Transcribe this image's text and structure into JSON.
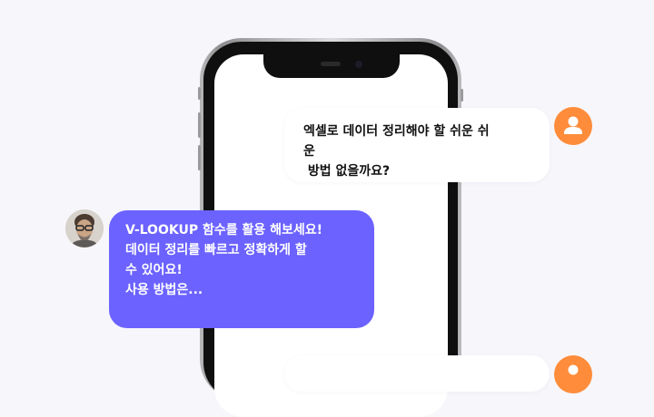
{
  "messages": [
    {
      "role": "user",
      "text": "엑셀로 데이터 정리해야 할 쉬운 쉬\n운\n 방법 없을까요?"
    },
    {
      "role": "assistant",
      "text": "V-LOOKUP 함수를 활용 해보세요!\n데이터 정리를 빠르고 정확하게 할\n수 있어요!\n사용 방법은..."
    }
  ],
  "colors": {
    "background": "#f7f6fb",
    "user_bubble": "#ffffff",
    "assistant_bubble": "#6b62ff",
    "user_avatar": "#ff8c3a"
  },
  "icons": {
    "user_avatar": "person-icon",
    "assistant_avatar": "photo-avatar"
  }
}
